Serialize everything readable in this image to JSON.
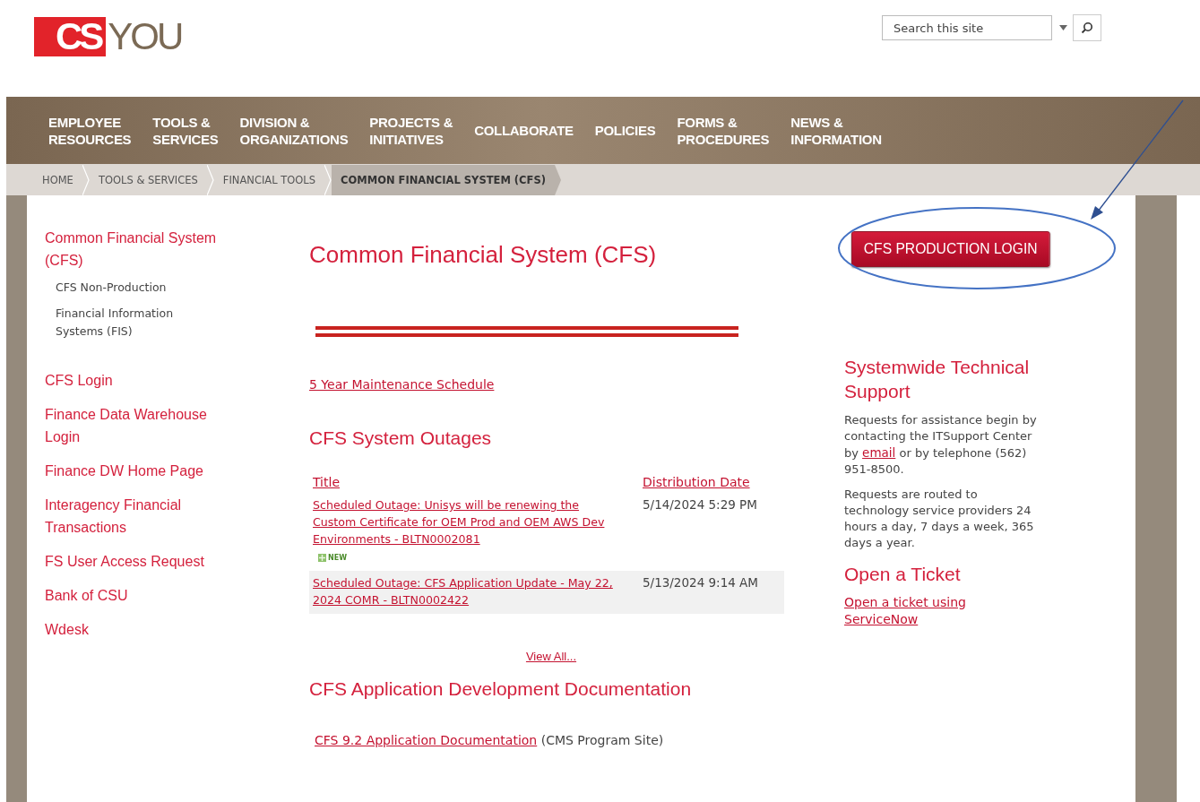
{
  "logo": {
    "mark": "CS",
    "word": "YOU"
  },
  "search": {
    "placeholder": "Search this site"
  },
  "nav": [
    {
      "lines": [
        "EMPLOYEE",
        "RESOURCES"
      ]
    },
    {
      "lines": [
        "TOOLS &",
        "SERVICES"
      ]
    },
    {
      "lines": [
        "DIVISION &",
        "ORGANIZATIONS"
      ]
    },
    {
      "lines": [
        "PROJECTS &",
        "INITIATIVES"
      ]
    },
    {
      "lines": [
        "COLLABORATE"
      ]
    },
    {
      "lines": [
        "POLICIES"
      ]
    },
    {
      "lines": [
        "FORMS &",
        "PROCEDURES"
      ]
    },
    {
      "lines": [
        "NEWS &",
        "INFORMATION"
      ]
    }
  ],
  "breadcrumb": [
    {
      "label": "HOME",
      "selected": false
    },
    {
      "label": "TOOLS & SERVICES",
      "selected": false
    },
    {
      "label": "FINANCIAL TOOLS",
      "selected": false
    },
    {
      "label": "COMMON FINANCIAL SYSTEM (CFS)",
      "selected": true
    }
  ],
  "sidebar": {
    "items": [
      {
        "label": "Common Financial System (CFS)",
        "kind": "main"
      },
      {
        "label": "CFS Non-Production",
        "kind": "sub"
      },
      {
        "label": "Financial Information Systems (FIS)",
        "kind": "sub"
      },
      {
        "label": "CFS Login",
        "kind": "link"
      },
      {
        "label": "Finance Data Warehouse Login",
        "kind": "link"
      },
      {
        "label": "Finance DW Home Page",
        "kind": "link"
      },
      {
        "label": "Interagency Financial Transactions",
        "kind": "link"
      },
      {
        "label": "FS User Access Request",
        "kind": "link"
      },
      {
        "label": "Bank of CSU",
        "kind": "link"
      },
      {
        "label": "Wdesk",
        "kind": "link"
      }
    ]
  },
  "main": {
    "title": "Common Financial System (CFS)",
    "maintenance_link": "5 Year Maintenance Schedule",
    "outages_heading": "CFS System Outages",
    "table": {
      "columns": [
        "Title",
        "Distribution Date"
      ],
      "rows": [
        {
          "title": "Scheduled Outage: Unisys will be renewing the Custom Certificate for OEM Prod and OEM AWS Dev Environments - BLTN0002081",
          "date": "5/14/2024 5:29 PM",
          "new": true,
          "new_label": "NEW"
        },
        {
          "title": "Scheduled Outage: CFS Application Update - May 22, 2024 COMR - BLTN0002422",
          "date": "5/13/2024 9:14 AM",
          "new": false
        }
      ]
    },
    "view_all": "View All...",
    "docs_heading": "CFS Application Development Documentation",
    "doc_link": "CFS 9.2 Application Documentation",
    "doc_note": "(CMS Program Site)"
  },
  "right": {
    "login_button": "CFS PRODUCTION LOGIN",
    "support_heading": "Systemwide Technical Support",
    "support_text_before": "Requests for assistance begin by contacting the ITSupport Center by",
    "support_link": "email",
    "support_text_after": "or by telephone (562) 951-8500.",
    "routing_text": "Requests are routed to technology service providers 24 hours a day, 7 days a week, 365 days a year.",
    "ticket_heading": "Open a Ticket",
    "ticket_link": "Open a ticket using ServiceNow"
  }
}
